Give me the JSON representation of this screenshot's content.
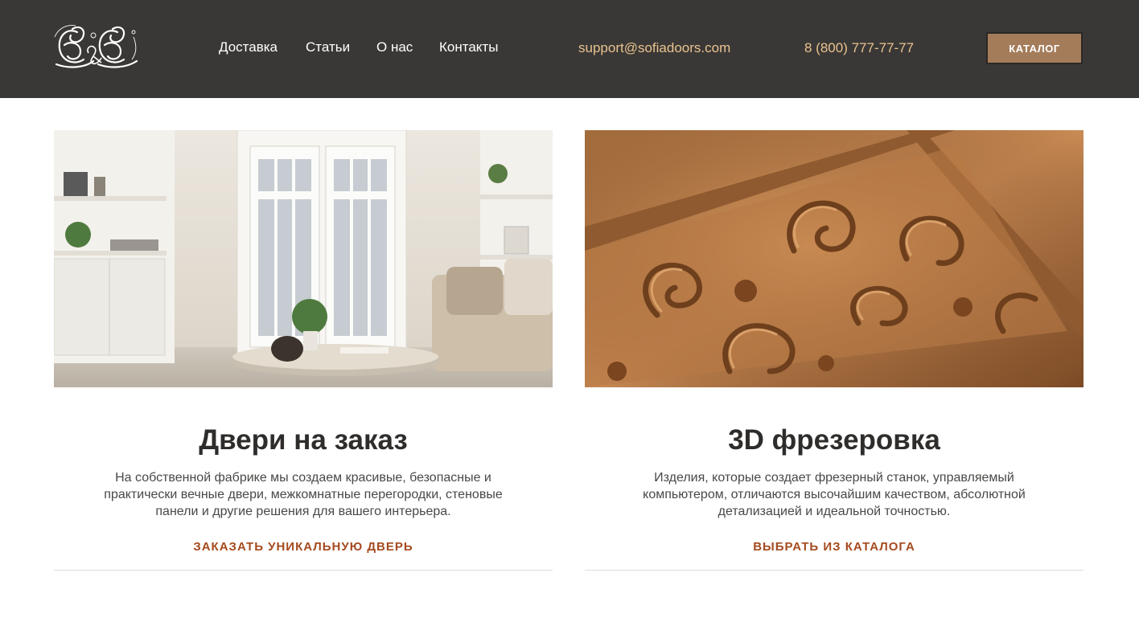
{
  "header": {
    "logo_alt": "S&S",
    "nav": [
      {
        "label": "Доставка"
      },
      {
        "label": "Статьи"
      },
      {
        "label": "О нас"
      },
      {
        "label": "Контакты"
      }
    ],
    "email": "support@sofiadoors.com",
    "phone": "8 (800) 777-77-77",
    "catalog_label": "КАТАЛОГ"
  },
  "cards": [
    {
      "image": "interior-doors-photo",
      "title": "Двери на заказ",
      "text": "На собственной фабрике мы создаем красивые, безопасные и практически вечные двери, межкомнатные перегородки, стеновые панели и другие решения для вашего интерьера.",
      "link": "ЗАКАЗАТЬ УНИКАЛЬНУЮ ДВЕРЬ"
    },
    {
      "image": "carved-wood-photo",
      "title": "3D фрезеровка",
      "text": "Изделия, которые создает фрезерный станок, управляемый компьютером, отличаются высочайшим качеством, абсолютной детализацией и идеальной точностью.",
      "link": "ВЫБРАТЬ ИЗ КАТАЛОГА"
    }
  ],
  "colors": {
    "header_bg": "#3a3836",
    "accent": "#a47c5a",
    "link": "#a54a1f",
    "contact": "#e9c28f"
  }
}
